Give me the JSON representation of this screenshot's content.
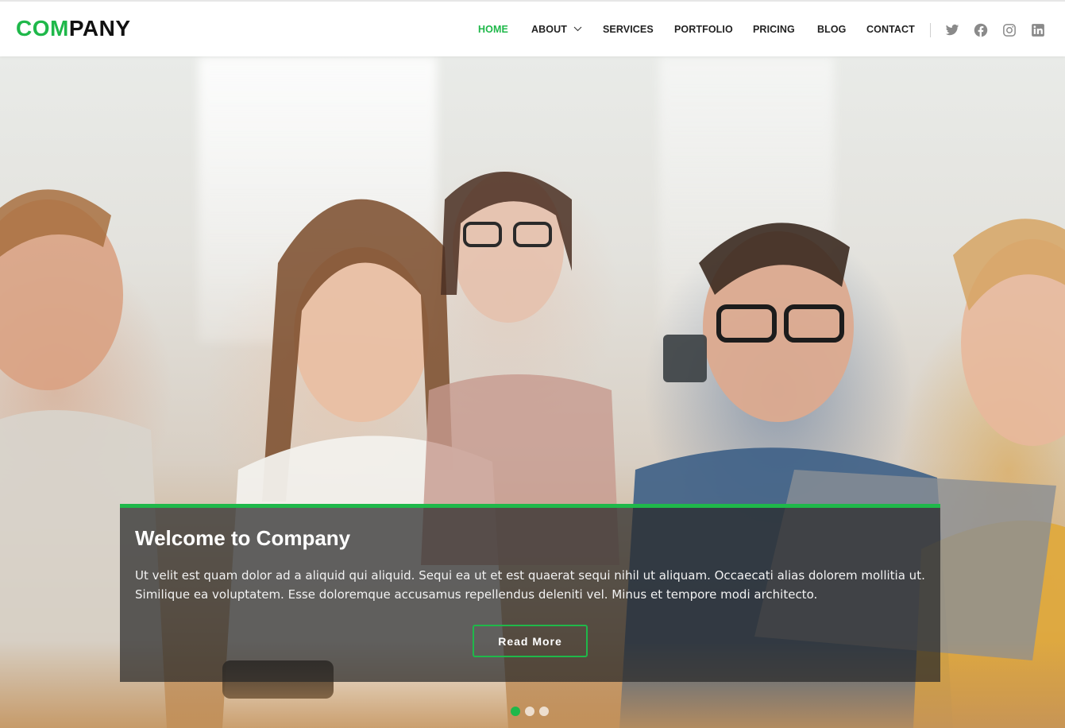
{
  "brand": {
    "logo_accent": "COM",
    "logo_rest": "PANY",
    "accent_color": "#1fb84a"
  },
  "nav": {
    "items": [
      {
        "label": "HOME",
        "active": true
      },
      {
        "label": "ABOUT",
        "has_dropdown": true
      },
      {
        "label": "SERVICES"
      },
      {
        "label": "PORTFOLIO"
      },
      {
        "label": "PRICING"
      },
      {
        "label": "BLOG"
      },
      {
        "label": "CONTACT"
      }
    ],
    "social": [
      "twitter-icon",
      "facebook-icon",
      "instagram-icon",
      "linkedin-icon"
    ]
  },
  "hero": {
    "title": "Welcome to Company",
    "text": "Ut velit est quam dolor ad a aliquid qui aliquid. Sequi ea ut et est quaerat sequi nihil ut aliquam. Occaecati alias dolorem mollitia ut. Similique ea voluptatem. Esse doloremque accusamus repellendus deleniti vel. Minus et tempore modi architecto.",
    "button_label": "Read More",
    "slides_total": 3,
    "active_slide": 1
  }
}
